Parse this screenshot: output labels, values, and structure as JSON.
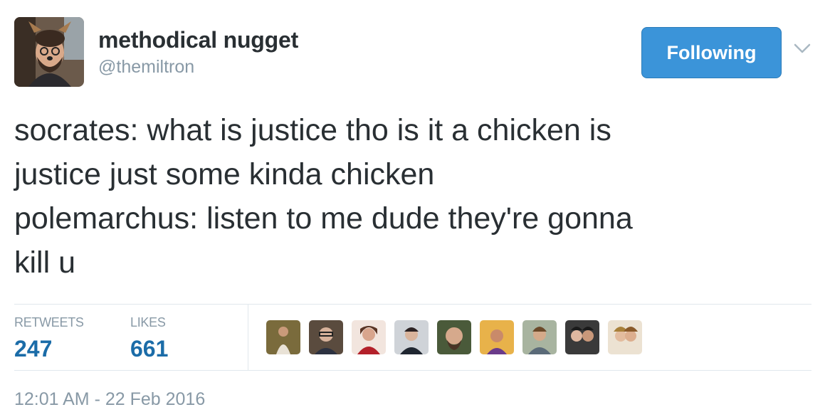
{
  "user": {
    "display_name": "methodical nugget",
    "handle": "@themiltron",
    "avatar_icon": "profile-photo-avatar"
  },
  "follow_button": {
    "label": "Following",
    "color": "#3b94d9"
  },
  "menu": {
    "icon": "chevron-down-icon"
  },
  "tweet": {
    "lines": [
      "socrates: what is justice tho is it a chicken is",
      "justice just some kinda chicken",
      "polemarchus: listen to me dude they're gonna",
      "kill u"
    ]
  },
  "stats": {
    "retweets_label": "RETWEETS",
    "retweets_value": "247",
    "likes_label": "LIKES",
    "likes_value": "661"
  },
  "liker_avatars": [
    "liker-avatar-1",
    "liker-avatar-2",
    "liker-avatar-3",
    "liker-avatar-4",
    "liker-avatar-5",
    "liker-avatar-6",
    "liker-avatar-7",
    "liker-avatar-8",
    "liker-avatar-9"
  ],
  "timestamp": "12:01 AM - 22 Feb 2016",
  "colors": {
    "text": "#292f33",
    "muted": "#8899a6",
    "stat_value": "#1b6ca8",
    "divider": "#e1e8ed"
  }
}
